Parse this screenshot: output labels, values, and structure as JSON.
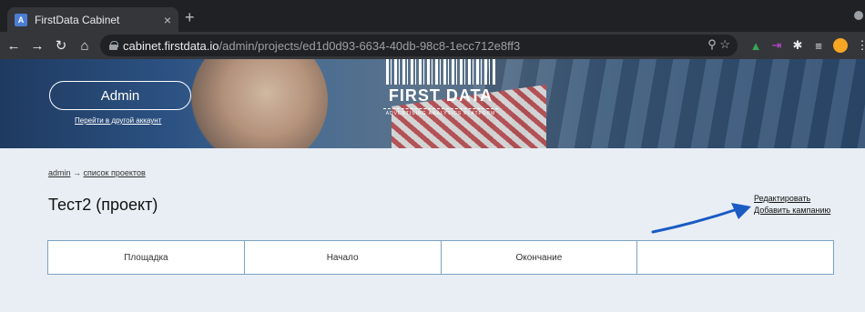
{
  "browser": {
    "tab_title": "FirstData Cabinet",
    "tab_close": "×",
    "new_tab": "+",
    "url_host": "cabinet.firstdata.io",
    "url_path": "/admin/projects/ed1d0d93-6634-40db-98c8-1ecc712e8ff3",
    "favicon_letter": "A"
  },
  "banner": {
    "admin_button": "Admin",
    "switch_account": "Перейти в другой аккаунт",
    "logo_text": "FIRST DATA",
    "logo_tagline": "ADVERTISING ANALYTICS PLATFORM"
  },
  "breadcrumb": {
    "items": [
      "admin",
      "список проектов"
    ],
    "separator": "→"
  },
  "page": {
    "title": "Тест2 (проект)"
  },
  "actions": {
    "edit": "Редактировать",
    "add_campaign": "Добавить кампанию"
  },
  "table": {
    "headers": [
      "Площадка",
      "Начало",
      "Окончание",
      ""
    ]
  },
  "colors": {
    "arrow": "#1a5bc4",
    "table_border": "#7aa3c4",
    "page_bg": "#e8eef4"
  }
}
